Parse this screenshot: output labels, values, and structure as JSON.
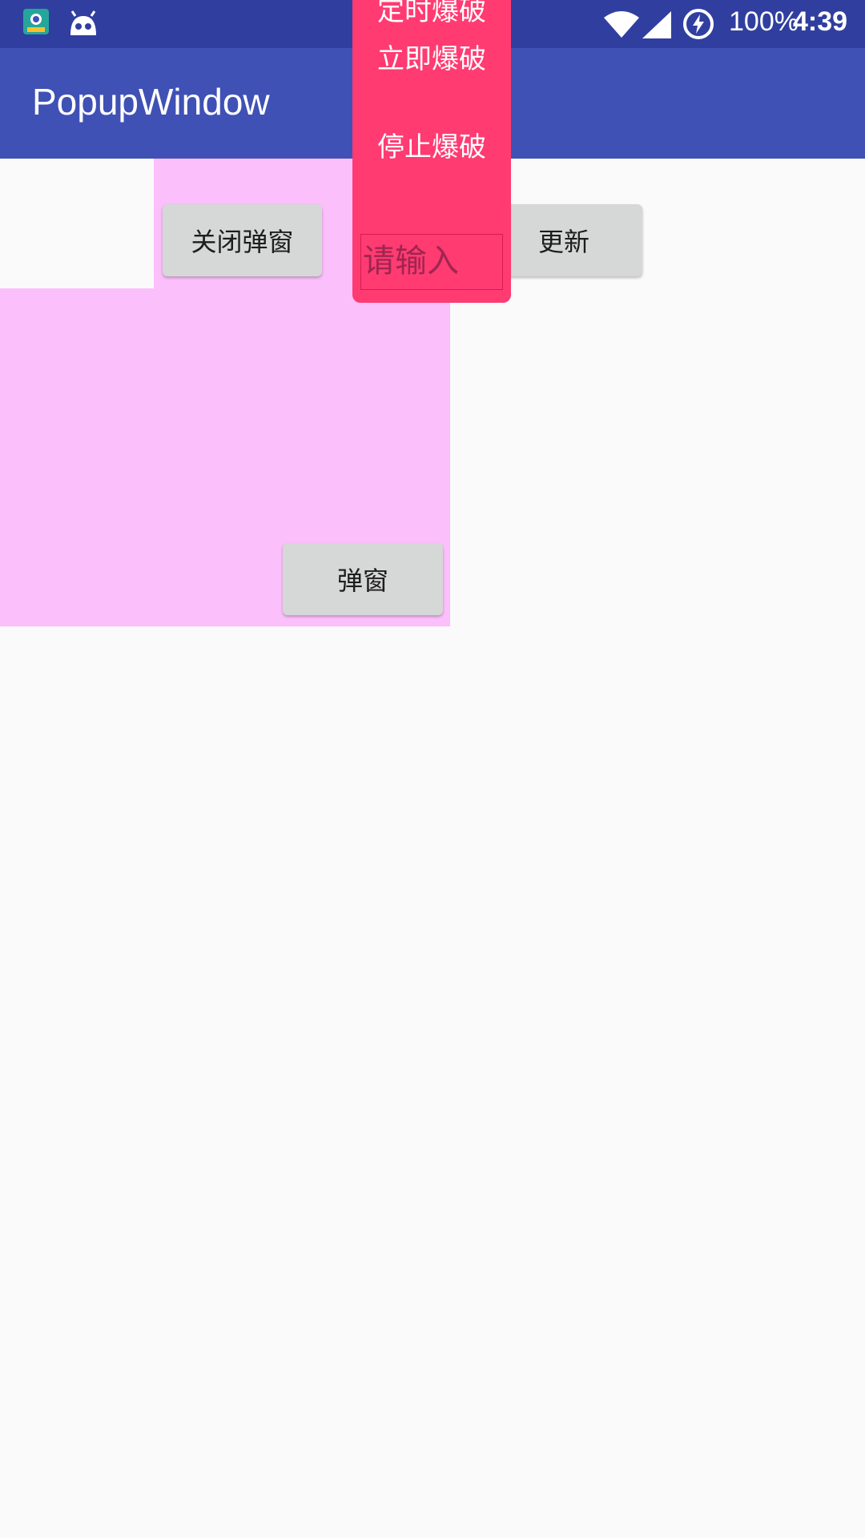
{
  "status_bar": {
    "battery_text": "100%",
    "time": "4:39",
    "icons": [
      "photo-app-icon",
      "android-debug-icon",
      "wifi-icon",
      "signal-icon",
      "battery-saver-icon"
    ]
  },
  "app_bar": {
    "title": "PopupWindow"
  },
  "buttons": {
    "close_popup": "关闭弹窗",
    "update": "更新",
    "popup": "弹窗"
  },
  "popup_menu": {
    "items": [
      "定时爆破",
      "立即爆破",
      "停止爆破"
    ],
    "input_placeholder": "请输入"
  },
  "colors": {
    "status_bar": "#303f9f",
    "app_bar": "#3f51b5",
    "popup": "#ff3b72",
    "pink_overlay": "#fbbffb",
    "button": "#d6d7d7",
    "background": "#fafafa"
  }
}
